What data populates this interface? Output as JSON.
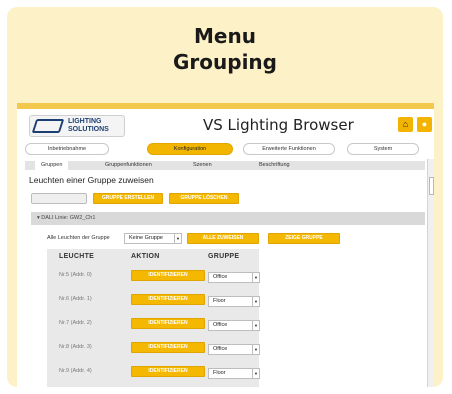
{
  "card": {
    "title_line1": "Menu",
    "title_line2": "Grouping"
  },
  "app": {
    "logo_line1": "LIGHTING",
    "logo_line2": "SOLUTIONS",
    "title": "VS Lighting Browser",
    "home_icon": "home-icon",
    "bulb_icon": "bulb-icon"
  },
  "main_tabs": [
    {
      "label": "Inbetriebnahme",
      "active": false
    },
    {
      "label": "Konfiguration",
      "active": true
    },
    {
      "label": "Erweiterte Funktionen",
      "active": false
    },
    {
      "label": "System",
      "active": false
    }
  ],
  "sub_tabs": [
    {
      "label": "Gruppen",
      "active": true
    },
    {
      "label": "Gruppenfunktionen",
      "active": false
    },
    {
      "label": "Szenen",
      "active": false
    },
    {
      "label": "Beschriftung",
      "active": false
    }
  ],
  "heading": "Leuchten einer Gruppe zuweisen",
  "create_button": "GRUPPE ERSTELLEN",
  "delete_button": "GRUPPE LÖSCHEN",
  "section_label": "DALI Linie: GW2_Ch1",
  "assign": {
    "label": "Alle Leuchten der Gruppe",
    "group_select": "Keine Gruppe",
    "assign_all_button": "ALLE ZUWEISEN",
    "show_group_button": "ZEIGE GRUPPE"
  },
  "table": {
    "headers": [
      "LEUCHTE",
      "AKTION",
      "GRUPPE"
    ],
    "identify_label": "IDENTIFIZIEREN",
    "rows": [
      {
        "name": "Nr.5 (Addr. 0)",
        "group": "Office"
      },
      {
        "name": "Nr.6 (Addr. 1)",
        "group": "Floor"
      },
      {
        "name": "Nr.7 (Addr. 2)",
        "group": "Office"
      },
      {
        "name": "Nr.8 (Addr. 3)",
        "group": "Office"
      },
      {
        "name": "Nr.9 (Addr. 4)",
        "group": "Floor"
      }
    ]
  },
  "colors": {
    "accent": "#f5b800",
    "card_bg": "#fdf1c8",
    "panel_bg": "#e9e9e9"
  }
}
